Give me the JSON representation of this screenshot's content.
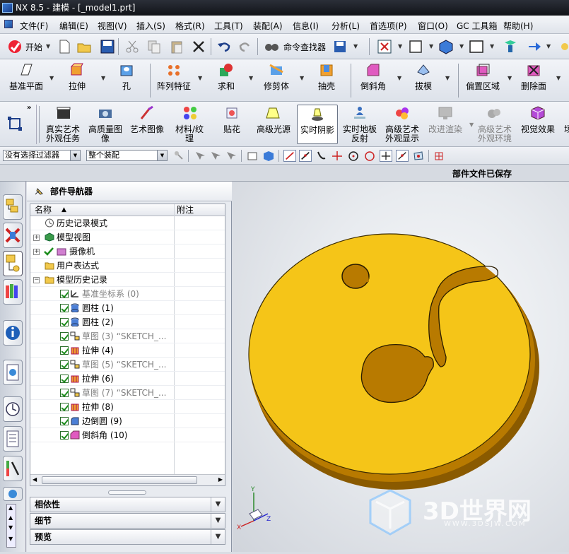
{
  "window": {
    "title": "NX 8.5 - 建模 - [_model1.prt]"
  },
  "menubar": [
    "文件(F)",
    "编辑(E)",
    "视图(V)",
    "插入(S)",
    "格式(R)",
    "工具(T)",
    "装配(A)",
    "信息(I)",
    "分析(L)",
    "首选项(P)",
    "窗口(O)",
    "GC 工具箱",
    "帮助(H)"
  ],
  "toolbar1": {
    "start_label": "开始",
    "finder_label": "命令查找器"
  },
  "toolbar2": {
    "items": [
      "基准平面",
      "拉伸",
      "孔",
      "阵列特征",
      "求和",
      "修剪体",
      "抽壳",
      "倒斜角",
      "拔模",
      "偏置区域",
      "删除面"
    ]
  },
  "toolbar3": {
    "items": [
      "真实艺术\n外观任务",
      "高质量图\n像",
      "艺术图像",
      "材料/纹\n理",
      "贴花",
      "高级光源",
      "实时阴影",
      "实时地板\n反射",
      "高级艺术\n外观显示",
      "改进渲染",
      "高级艺术\n外观环境",
      "视觉效果",
      "场"
    ]
  },
  "selbar": {
    "filter": "没有选择过滤器",
    "scope": "整个装配"
  },
  "status": {
    "message": "部件文件已保存"
  },
  "navigator": {
    "title": "部件导航器",
    "col_name": "名称",
    "col_note": "附注",
    "rows": [
      {
        "label": "历史记录模式",
        "grey": false
      },
      {
        "label": "模型视图",
        "grey": false
      },
      {
        "label": "摄像机",
        "grey": false
      },
      {
        "label": "用户表达式",
        "grey": false
      },
      {
        "label": "模型历史记录",
        "grey": false
      },
      {
        "label": "基准坐标系 (0)",
        "grey": true
      },
      {
        "label": "圆柱 (1)",
        "grey": false
      },
      {
        "label": "圆柱 (2)",
        "grey": false
      },
      {
        "label": "草图 (3) “SKETCH_...",
        "grey": true
      },
      {
        "label": "拉伸 (4)",
        "grey": false
      },
      {
        "label": "草图 (5) “SKETCH_...",
        "grey": true
      },
      {
        "label": "拉伸 (6)",
        "grey": false
      },
      {
        "label": "草图 (7) “SKETCH_...",
        "grey": true
      },
      {
        "label": "拉伸 (8)",
        "grey": false
      },
      {
        "label": "边倒圆 (9)",
        "grey": false
      },
      {
        "label": "倒斜角 (10)",
        "grey": false
      }
    ],
    "sections": [
      "相依性",
      "细节",
      "预览"
    ]
  },
  "viewport": {
    "watermark": "3D世界网",
    "watermark_url": "WWW.3DSJW.COM",
    "part_color": "#f5c518"
  }
}
